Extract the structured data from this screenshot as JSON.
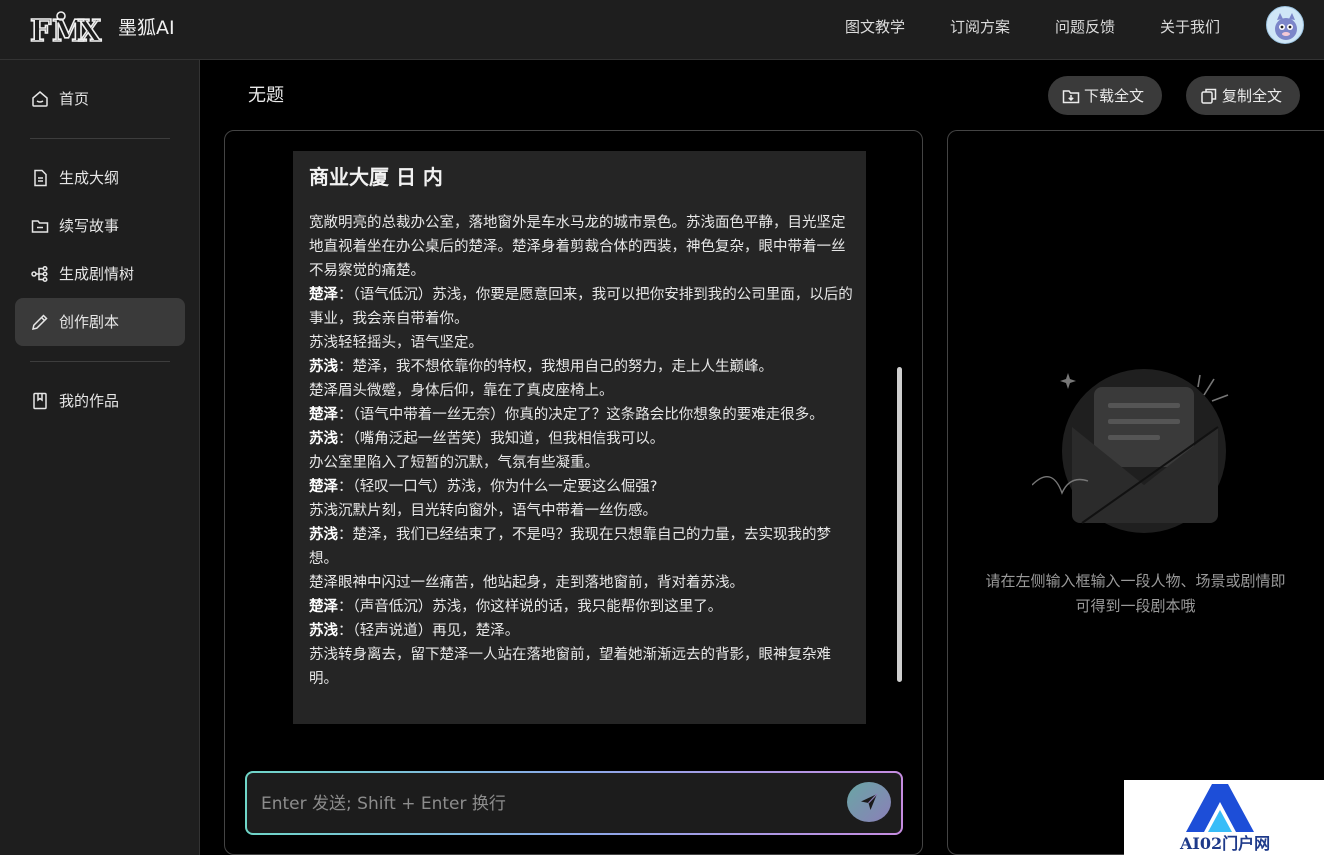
{
  "header": {
    "brand": "墨狐AI",
    "logo_text": "FMX",
    "nav": [
      "图文教学",
      "订阅方案",
      "问题反馈",
      "关于我们"
    ]
  },
  "sidebar": {
    "items": [
      {
        "label": "首页",
        "icon": "home-icon"
      },
      {
        "label": "生成大纲",
        "icon": "document-icon"
      },
      {
        "label": "续写故事",
        "icon": "folder-icon"
      },
      {
        "label": "生成剧情树",
        "icon": "tree-icon"
      },
      {
        "label": "创作剧本",
        "icon": "pencil-icon",
        "active": true
      },
      {
        "label": "我的作品",
        "icon": "bookmark-icon"
      }
    ]
  },
  "main": {
    "title": "无题",
    "download_label": "下载全文",
    "copy_label": "复制全文",
    "script": {
      "heading": "商业大厦 日 内",
      "lines": [
        {
          "speaker": "",
          "text": "宽敞明亮的总裁办公室，落地窗外是车水马龙的城市景色。苏浅面色平静，目光坚定地直视着坐在办公桌后的楚泽。楚泽身着剪裁合体的西装，神色复杂，眼中带着一丝不易察觉的痛楚。"
        },
        {
          "speaker": "楚泽",
          "text": "：（语气低沉）苏浅，你要是愿意回来，我可以把你安排到我的公司里面，以后的事业，我会亲自带着你。"
        },
        {
          "speaker": "",
          "text": "苏浅轻轻摇头，语气坚定。"
        },
        {
          "speaker": "苏浅",
          "text": "：楚泽，我不想依靠你的特权，我想用自己的努力，走上人生巅峰。"
        },
        {
          "speaker": "",
          "text": "楚泽眉头微蹙，身体后仰，靠在了真皮座椅上。"
        },
        {
          "speaker": "楚泽",
          "text": "：（语气中带着一丝无奈）你真的决定了？这条路会比你想象的要难走很多。"
        },
        {
          "speaker": "苏浅",
          "text": "：（嘴角泛起一丝苦笑）我知道，但我相信我可以。"
        },
        {
          "speaker": "",
          "text": "办公室里陷入了短暂的沉默，气氛有些凝重。"
        },
        {
          "speaker": "楚泽",
          "text": "：（轻叹一口气）苏浅，你为什么一定要这么倔强?"
        },
        {
          "speaker": "",
          "text": "苏浅沉默片刻，目光转向窗外，语气中带着一丝伤感。"
        },
        {
          "speaker": "苏浅",
          "text": "：楚泽，我们已经结束了，不是吗？我现在只想靠自己的力量，去实现我的梦想。"
        },
        {
          "speaker": "",
          "text": "楚泽眼神中闪过一丝痛苦，他站起身，走到落地窗前，背对着苏浅。"
        },
        {
          "speaker": "楚泽",
          "text": "：（声音低沉）苏浅，你这样说的话，我只能帮你到这里了。"
        },
        {
          "speaker": "苏浅",
          "text": "：（轻声说道）再见，楚泽。"
        },
        {
          "speaker": "",
          "text": "苏浅转身离去，留下楚泽一人站在落地窗前，望着她渐渐远去的背影，眼神复杂难明。"
        }
      ]
    },
    "input": {
      "placeholder": "Enter 发送; Shift + Enter 换行",
      "value": ""
    }
  },
  "preview": {
    "empty_text": "请在左侧输入框输入一段人物、场景或剧情即可得到一段剧本哦"
  },
  "watermark": {
    "text": "AI02门户网"
  },
  "colors": {
    "background": "#000000",
    "panel": "#1e1e1e",
    "active_item": "#3a3a3a",
    "card": "#252525",
    "input_gradient_start": "#6fd6c8",
    "input_gradient_end": "#c58ce0"
  }
}
